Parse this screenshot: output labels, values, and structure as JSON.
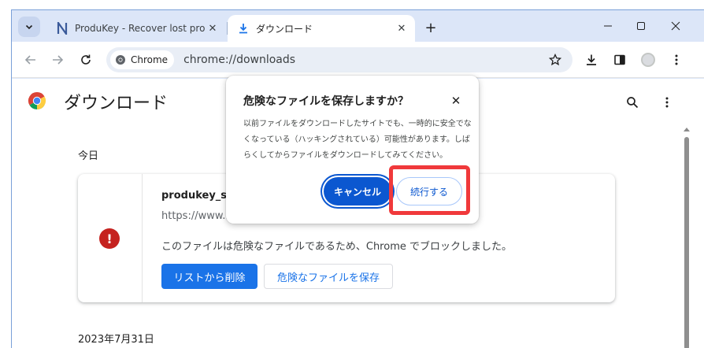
{
  "tabs": [
    {
      "title": "ProduKey - Recover lost produc",
      "icon": "produkey-icon",
      "active": false
    },
    {
      "title": "ダウンロード",
      "icon": "download-icon",
      "active": true
    }
  ],
  "omnibox": {
    "chip_label": "Chrome",
    "url": "chrome://downloads"
  },
  "page": {
    "title": "ダウンロード"
  },
  "sections": {
    "today": "今日",
    "older_date": "2023年7月31日"
  },
  "download_item": {
    "filename": "produkey_setup.exe",
    "url": "https://www.nirsoft.net/",
    "status_message": "このファイルは危険なファイルであるため、Chrome でブロックしました。",
    "remove_button": "リストから削除",
    "save_button": "危険なファイルを保存"
  },
  "dialog": {
    "title": "危険なファイルを保存しますか？",
    "body_lines": [
      "以前ファイルをダウンロードしたサイトでも、一時的に安全でな",
      "くなっている（ハッキングされている）可能性があります。しば",
      "らくしてからファイルをダウンロードしてみてください。"
    ],
    "cancel_button": "キャンセル",
    "continue_button": "続行する"
  },
  "colors": {
    "accent": "#1a73e8",
    "danger": "#c5221f",
    "highlight": "#f0393b",
    "dialog_primary": "#0b57d0"
  }
}
